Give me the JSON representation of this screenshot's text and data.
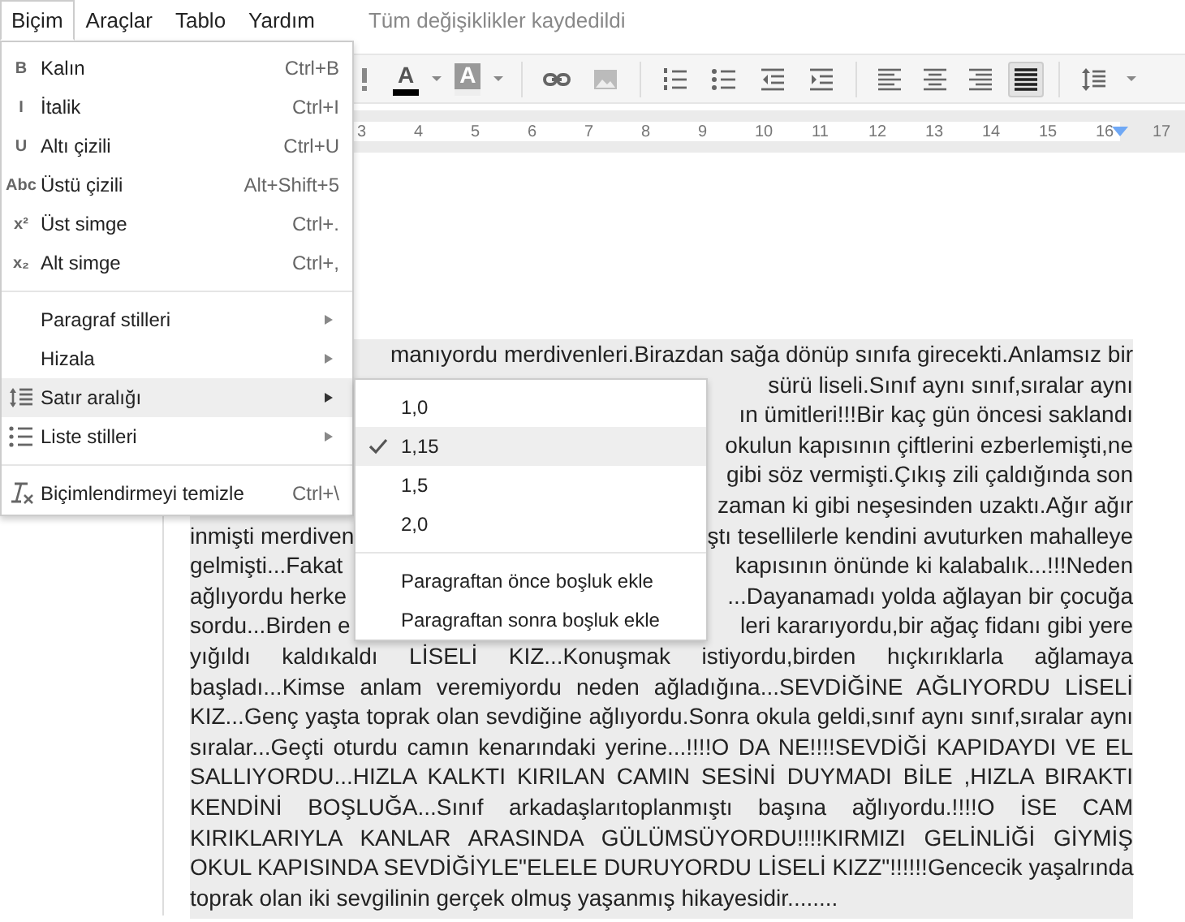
{
  "menubar": {
    "items": [
      {
        "label": "Biçim",
        "selected": true
      },
      {
        "label": "Araçlar",
        "selected": false
      },
      {
        "label": "Tablo",
        "selected": false
      },
      {
        "label": "Yardım",
        "selected": false
      }
    ],
    "status": "Tüm değişiklikler kaydedildi"
  },
  "toolbar": [
    {
      "kind": "fragment"
    },
    {
      "kind": "textcolor",
      "label": "A"
    },
    {
      "kind": "dropdown"
    },
    {
      "kind": "highlight",
      "label": "A"
    },
    {
      "kind": "dropdown"
    },
    {
      "kind": "sep"
    },
    {
      "kind": "link"
    },
    {
      "kind": "image"
    },
    {
      "kind": "sep"
    },
    {
      "kind": "numbered"
    },
    {
      "kind": "bulleted"
    },
    {
      "kind": "outdent"
    },
    {
      "kind": "indent"
    },
    {
      "kind": "sep"
    },
    {
      "kind": "align",
      "selected": false
    },
    {
      "kind": "center",
      "selected": false
    },
    {
      "kind": "right",
      "selected": false
    },
    {
      "kind": "justify",
      "selected": true
    },
    {
      "kind": "sep"
    },
    {
      "kind": "spacing"
    },
    {
      "kind": "dropdown"
    }
  ],
  "ruler": [
    "3",
    "4",
    "5",
    "6",
    "7",
    "8",
    "9",
    "10",
    "11",
    "12",
    "13",
    "14",
    "15",
    "16",
    "17"
  ],
  "document": {
    "lines": [
      {
        "kind": "split",
        "right": "manıyordu merdivenleri.Birazdan sağa dönüp sınıfa girecekti.Anlamsız bir"
      },
      {
        "kind": "split",
        "right": "sürü liseli.Sınıf aynı sınıf,sıralar aynı"
      },
      {
        "kind": "split",
        "right": "ın ümitleri!!!Bir kaç gün öncesi saklandı"
      },
      {
        "kind": "split",
        "right": "okulun kapısının çiftlerini ezberlemişti,ne"
      },
      {
        "kind": "split",
        "right": "gibi söz vermişti.Çıkış zili çaldığında son"
      },
      {
        "kind": "split",
        "right": "zaman ki gibi neşesinden uzaktı.Ağır ağır"
      },
      {
        "kind": "split",
        "left": "inmişti merdiven",
        "right": "ştı tesellilerle kendini avuturken mahalleye"
      },
      {
        "kind": "split",
        "left": "gelmişti...Fakat",
        "right": "kapısının önünde ki kalabalık...!!!Neden"
      },
      {
        "kind": "split",
        "left": "ağlıyordu herke",
        "right": "...Dayanamadı yolda ağlayan bir çocuğa"
      },
      {
        "kind": "split",
        "left": "sordu...Birden e",
        "right": "leri kararıyordu,bir ağaç fidanı gibi yere"
      },
      {
        "kind": "full",
        "text": "yığıldı kaldıkaldı LİSELİ KIZ...Konuşmak istiyordu,birden hıçkırıklarla ağlamaya"
      },
      {
        "kind": "full",
        "text": "başladı...Kimse anlam veremiyordu neden ağladığına...SEVDİĞİNE AĞLIYORDU LİSELİ"
      },
      {
        "kind": "full",
        "text": "KIZ...Genç yaşta toprak olan sevdiğine ağlıyordu.Sonra okula geldi,sınıf aynı sınıf,sıralar aynı"
      },
      {
        "kind": "full",
        "text": "sıralar...Geçti oturdu camın kenarındaki yerine...!!!!O DA NE!!!!SEVDİĞİ KAPIDAYDI VE EL"
      },
      {
        "kind": "full",
        "text": "SALLIYORDU...HIZLA KALKTI KIRILAN CAMIN SESİNİ DUYMADI BİLE ,HIZLA BIRAKTI"
      },
      {
        "kind": "full",
        "text": "KENDİNİ BOŞLUĞA...Sınıf arkadaşlarıtoplanmıştı başına ağlıyordu.!!!!O İSE CAM"
      },
      {
        "kind": "full",
        "text": "KIRIKLARIYLA KANLAR ARASINDA GÜLÜMSÜYORDU!!!!KIRMIZI GELİNLİĞİ GİYMİŞ"
      },
      {
        "kind": "full",
        "text": "OKUL KAPISINDA SEVDİĞİYLE\"ELELE DURUYORDU LİSELİ KIZZ\"!!!!!!Gencecik yaşalrında"
      },
      {
        "kind": "last",
        "text": "toprak olan iki sevgilinin gerçek olmuş yaşanmış hikayesidir........"
      }
    ]
  },
  "format_menu": {
    "items": [
      {
        "kind": "glyph",
        "icon": "B",
        "label": "Kalın",
        "shortcut": "Ctrl+B",
        "submenu": false,
        "highlighted": false
      },
      {
        "kind": "glyph",
        "icon": "I",
        "label": "İtalik",
        "shortcut": "Ctrl+I",
        "submenu": false,
        "highlighted": false
      },
      {
        "kind": "glyph",
        "icon": "U",
        "label": "Altı çizili",
        "shortcut": "Ctrl+U",
        "submenu": false,
        "highlighted": false
      },
      {
        "kind": "glyph",
        "icon": "Abc",
        "label": "Üstü çizili",
        "shortcut": "Alt+Shift+5",
        "submenu": false,
        "highlighted": false
      },
      {
        "kind": "glyph",
        "icon": "x²",
        "label": "Üst simge",
        "shortcut": "Ctrl+.",
        "submenu": false,
        "highlighted": false
      },
      {
        "kind": "glyph",
        "icon": "x₂",
        "label": "Alt simge",
        "shortcut": "Ctrl+,",
        "submenu": false,
        "highlighted": false
      },
      {
        "kind": "separator"
      },
      {
        "kind": "plain",
        "label": "Paragraf stilleri",
        "submenu": true,
        "highlighted": false
      },
      {
        "kind": "plain",
        "label": "Hizala",
        "submenu": true,
        "highlighted": false
      },
      {
        "kind": "spacing",
        "label": "Satır aralığı",
        "submenu": true,
        "highlighted": true
      },
      {
        "kind": "list",
        "label": "Liste stilleri",
        "submenu": true,
        "highlighted": false
      },
      {
        "kind": "separator"
      },
      {
        "kind": "clear",
        "label": "Biçimlendirmeyi temizle",
        "shortcut": "Ctrl+\\",
        "submenu": false,
        "highlighted": false
      }
    ]
  },
  "spacing_menu": {
    "items": [
      {
        "kind": "option",
        "label": "1,0",
        "selected": false
      },
      {
        "kind": "option",
        "label": "1,15",
        "selected": true
      },
      {
        "kind": "option",
        "label": "1,5",
        "selected": false
      },
      {
        "kind": "option",
        "label": "2,0",
        "selected": false
      },
      {
        "kind": "separator"
      },
      {
        "kind": "action",
        "label": "Paragraftan önce boşluk ekle"
      },
      {
        "kind": "action",
        "label": "Paragraftan sonra boşluk ekle"
      }
    ]
  }
}
